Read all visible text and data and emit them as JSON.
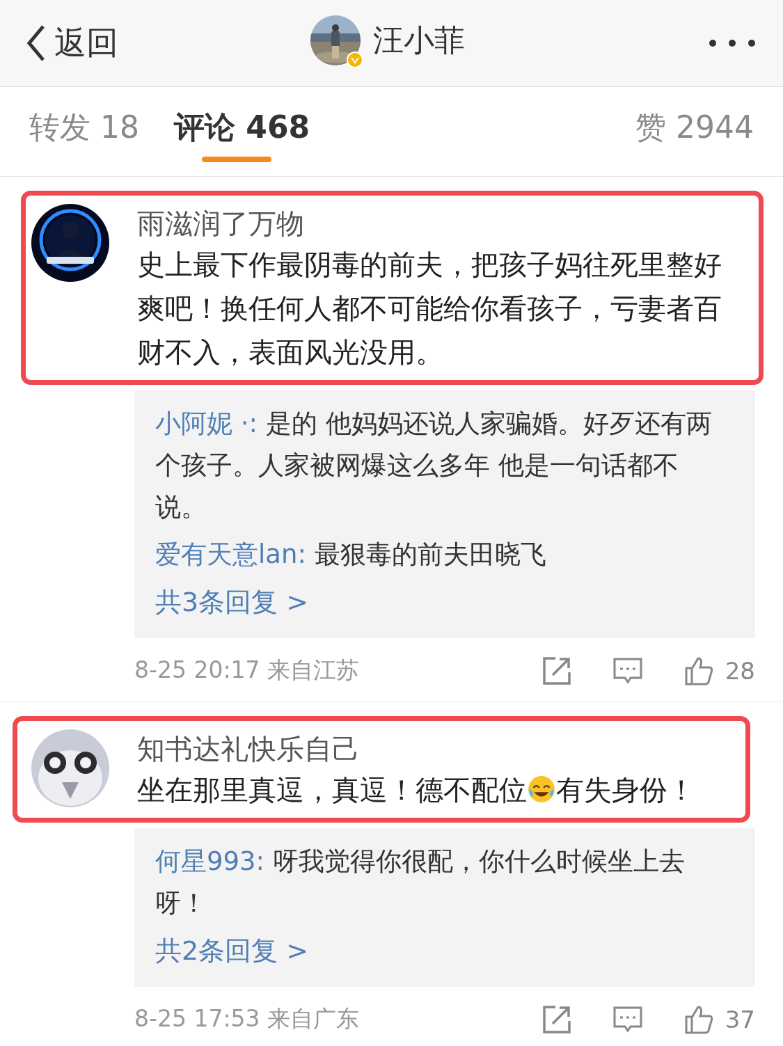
{
  "header": {
    "back_label": "返回",
    "title": "汪小菲",
    "verified": true
  },
  "tabs": [
    {
      "label": "转发 18",
      "selected": false
    },
    {
      "label": "评论 468",
      "selected": true
    },
    {
      "label": "赞 2944",
      "selected": false
    }
  ],
  "comments": [
    {
      "author": "雨滋润了万物",
      "highlighted": true,
      "content": [
        {
          "kind": "text",
          "text": "史上最下作最阴毒的前夫，把孩子妈往死里整好爽吧！换任何人都不可能给你看孩子，亏妻者百财不入，表面风光没用。"
        }
      ],
      "replies": [
        {
          "author": "小阿妮 ·:",
          "text": " 是的 他妈妈还说人家骗婚。好歹还有两个孩子。人家被网爆这么多年 他是一句话都不说。"
        },
        {
          "author": "爱有天意lan:",
          "text": " 最狠毒的前夫田晓飞"
        }
      ],
      "more_replies": "共3条回复 >",
      "time": "8-25 20:17 来自江苏",
      "likes": "28"
    },
    {
      "author": "知书达礼快乐自己",
      "highlighted": true,
      "content": [
        {
          "kind": "text",
          "text": "坐在那里真逗，真逗！德不配位"
        },
        {
          "kind": "emoji"
        },
        {
          "kind": "text",
          "text": "有失身份！"
        }
      ],
      "replies": [
        {
          "author": "何星993:",
          "text": " 呀我觉得你很配，你什么时候坐上去呀！"
        }
      ],
      "more_replies": "共2条回复 >",
      "time": "8-25 17:53 来自广东",
      "likes": "37"
    }
  ]
}
